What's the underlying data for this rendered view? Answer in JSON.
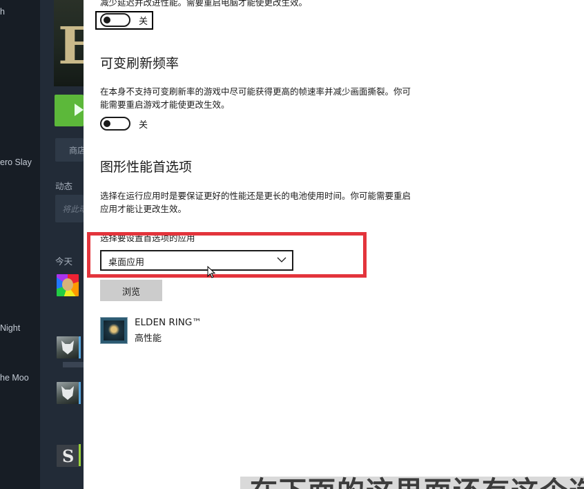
{
  "background_app": {
    "library_items": [
      "h",
      "ero Slay",
      "Night",
      "he Moo"
    ],
    "store_label": "商店",
    "activity_label": "动态",
    "activity_placeholder": "将此动",
    "today_label": "今天",
    "hero_glyph": "E",
    "thumb_glyph": "S"
  },
  "settings": {
    "top_cut_text": "减少延迟并改进性能。需要重启电脑才能使更改生效。",
    "top_toggle_state": "关",
    "vrr": {
      "title": "可变刷新频率",
      "description": "在本身不支持可变刷新率的游戏中尽可能获得更高的帧速率并减少画面撕裂。你可能需要重启游戏才能使更改生效。",
      "toggle_state": "关"
    },
    "gpu_pref": {
      "title": "图形性能首选项",
      "description": "选择在运行应用时是要保证更好的性能还是更长的电池使用时间。你可能需要重启应用才能让更改生效。",
      "select_label": "选择要设置首选项的应用",
      "select_value": "桌面应用",
      "browse_label": "浏览"
    },
    "app_entry": {
      "name": "ELDEN RING™",
      "preference": "高性能"
    }
  },
  "overlay": {
    "subtitle": "在下面的这里面还有这个选择下面"
  },
  "colors": {
    "highlight": "#e3343c",
    "steam_bg": "#1b2838",
    "play_green": "#5cb83a"
  }
}
